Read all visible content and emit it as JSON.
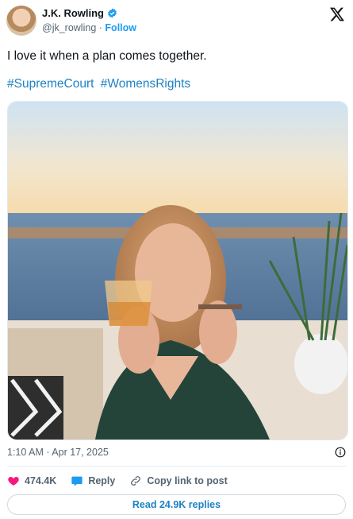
{
  "author": {
    "name": "J.K. Rowling",
    "handle": "@jk_rowling",
    "separator": "·",
    "follow_label": "Follow"
  },
  "tweet": {
    "text": "I love it when a plan comes together.",
    "hashtags": [
      "#SupremeCourt",
      "#WomensRights"
    ]
  },
  "meta": {
    "timestamp": "1:10 AM · Apr 17, 2025"
  },
  "actions": {
    "likes": "474.4K",
    "reply_label": "Reply",
    "copy_link_label": "Copy link to post"
  },
  "replies_button": "Read 24.9K replies",
  "colors": {
    "accent": "#1d9bf0",
    "like": "#f91880",
    "muted": "#536471"
  }
}
